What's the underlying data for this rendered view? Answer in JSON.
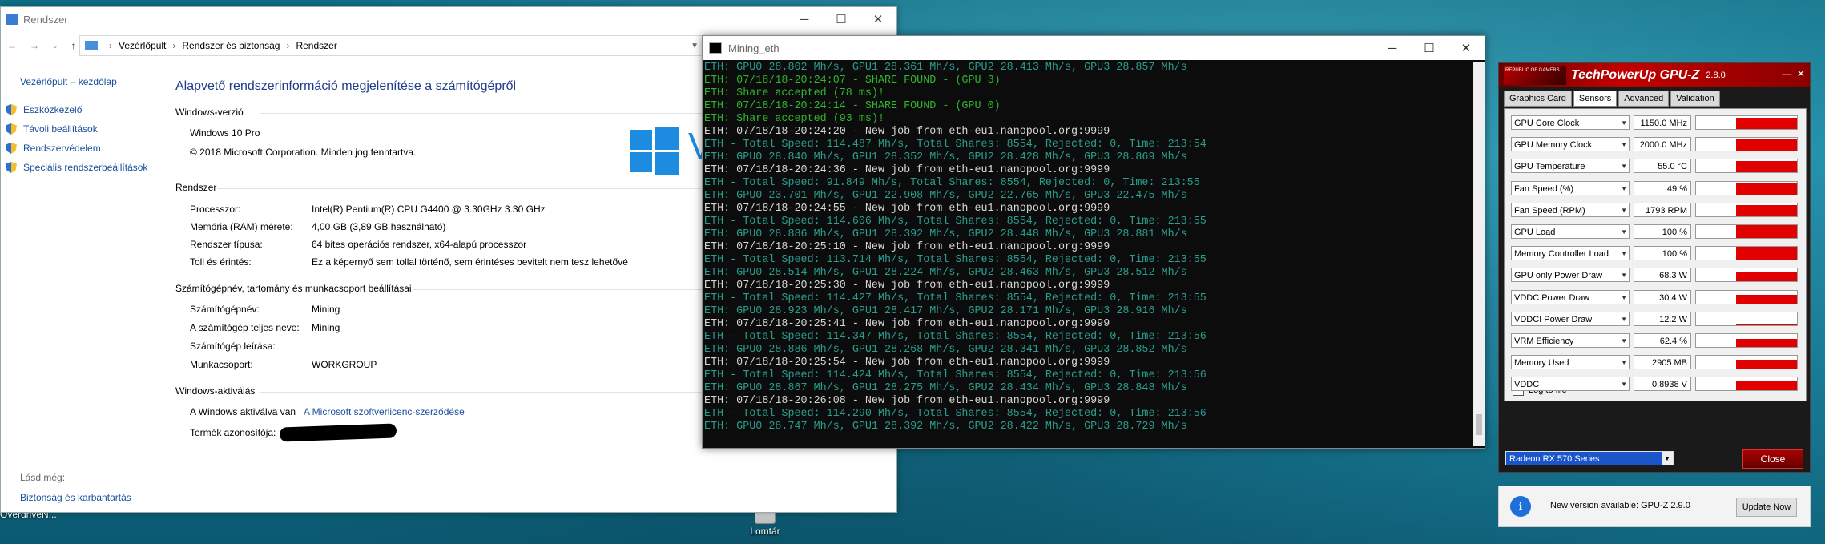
{
  "desktop": {
    "icons": [
      {
        "label": "OverdriveN...",
        "left": "0"
      },
      {
        "label": "Lomtár"
      }
    ]
  },
  "control_panel": {
    "title": "Rendszer",
    "address": [
      "Vezérlőpult",
      "Rendszer és biztonság",
      "Rendszer"
    ],
    "sidebar": {
      "home": "Vezérlőpult – kezdőlap",
      "items": [
        "Eszközkezelő",
        "Távoli beállítások",
        "Rendszervédelem",
        "Speciális rendszerbeállítások"
      ],
      "see_also": "Lásd még:",
      "see_link": "Biztonság és karbantartás"
    },
    "heading": "Alapvető rendszerinformáció megjelenítése a számítógépről",
    "windows_version": {
      "label": "Windows-verzió",
      "edition": "Windows 10 Pro",
      "copyright": "© 2018 Microsoft Corporation. Minden jog fenntartva."
    },
    "system": {
      "label": "Rendszer",
      "rows": [
        {
          "k": "Processzor:",
          "v": "Intel(R) Pentium(R) CPU G4400 @ 3.30GHz   3.30 GHz"
        },
        {
          "k": "Memória (RAM) mérete:",
          "v": "4,00 GB (3,89 GB használható)"
        },
        {
          "k": "Rendszer típusa:",
          "v": "64 bites operációs rendszer, x64-alapú processzor"
        },
        {
          "k": "Toll és érintés:",
          "v": "Ez a képernyő sem tollal történő, sem érintéses bevitelt nem tesz lehetővé"
        }
      ]
    },
    "computer": {
      "label": "Számítógépnév, tartomány és munkacsoport beállításai",
      "rows": [
        {
          "k": "Számítógépnév:",
          "v": "Mining"
        },
        {
          "k": "A számítógép teljes neve:",
          "v": "Mining"
        },
        {
          "k": "Számítógép leírása:",
          "v": ""
        },
        {
          "k": "Munkacsoport:",
          "v": "WORKGROUP"
        }
      ]
    },
    "activation": {
      "label": "Windows-aktiválás",
      "status": "A Windows aktiválva van",
      "link": "A Microsoft szoftverlicenc-szerződése",
      "product_id_label": "Termék azonosítója:"
    },
    "logo_text": "V"
  },
  "console": {
    "title": "Mining_eth",
    "lines": [
      {
        "c": "teal",
        "t": "ETH: GPU0 28.802 Mh/s, GPU1 28.361 Mh/s, GPU2 28.413 Mh/s, GPU3 28.857 Mh/s"
      },
      {
        "c": "green",
        "t": "ETH: 07/18/18-20:24:07 - SHARE FOUND - (GPU 3)"
      },
      {
        "c": "green",
        "t": "ETH: Share accepted (78 ms)!"
      },
      {
        "c": "green",
        "t": "ETH: 07/18/18-20:24:14 - SHARE FOUND - (GPU 0)"
      },
      {
        "c": "green",
        "t": "ETH: Share accepted (93 ms)!"
      },
      {
        "c": "white",
        "t": "ETH: 07/18/18-20:24:20 - New job from eth-eu1.nanopool.org:9999"
      },
      {
        "c": "teal",
        "t": "ETH - Total Speed: 114.487 Mh/s, Total Shares: 8554, Rejected: 0, Time: 213:54"
      },
      {
        "c": "teal",
        "t": "ETH: GPU0 28.840 Mh/s, GPU1 28.352 Mh/s, GPU2 28.428 Mh/s, GPU3 28.869 Mh/s"
      },
      {
        "c": "white",
        "t": "ETH: 07/18/18-20:24:36 - New job from eth-eu1.nanopool.org:9999"
      },
      {
        "c": "teal",
        "t": "ETH - Total Speed: 91.849 Mh/s, Total Shares: 8554, Rejected: 0, Time: 213:55"
      },
      {
        "c": "teal",
        "t": "ETH: GPU0 23.701 Mh/s, GPU1 22.908 Mh/s, GPU2 22.765 Mh/s, GPU3 22.475 Mh/s"
      },
      {
        "c": "white",
        "t": "ETH: 07/18/18-20:24:55 - New job from eth-eu1.nanopool.org:9999"
      },
      {
        "c": "teal",
        "t": "ETH - Total Speed: 114.606 Mh/s, Total Shares: 8554, Rejected: 0, Time: 213:55"
      },
      {
        "c": "teal",
        "t": "ETH: GPU0 28.886 Mh/s, GPU1 28.392 Mh/s, GPU2 28.448 Mh/s, GPU3 28.881 Mh/s"
      },
      {
        "c": "white",
        "t": "ETH: 07/18/18-20:25:10 - New job from eth-eu1.nanopool.org:9999"
      },
      {
        "c": "teal",
        "t": "ETH - Total Speed: 113.714 Mh/s, Total Shares: 8554, Rejected: 0, Time: 213:55"
      },
      {
        "c": "teal",
        "t": "ETH: GPU0 28.514 Mh/s, GPU1 28.224 Mh/s, GPU2 28.463 Mh/s, GPU3 28.512 Mh/s"
      },
      {
        "c": "white",
        "t": "ETH: 07/18/18-20:25:30 - New job from eth-eu1.nanopool.org:9999"
      },
      {
        "c": "teal",
        "t": "ETH - Total Speed: 114.427 Mh/s, Total Shares: 8554, Rejected: 0, Time: 213:55"
      },
      {
        "c": "teal",
        "t": "ETH: GPU0 28.923 Mh/s, GPU1 28.417 Mh/s, GPU2 28.171 Mh/s, GPU3 28.916 Mh/s"
      },
      {
        "c": "white",
        "t": "ETH: 07/18/18-20:25:41 - New job from eth-eu1.nanopool.org:9999"
      },
      {
        "c": "teal",
        "t": "ETH - Total Speed: 114.347 Mh/s, Total Shares: 8554, Rejected: 0, Time: 213:56"
      },
      {
        "c": "teal",
        "t": "ETH: GPU0 28.886 Mh/s, GPU1 28.268 Mh/s, GPU2 28.341 Mh/s, GPU3 28.852 Mh/s"
      },
      {
        "c": "white",
        "t": "ETH: 07/18/18-20:25:54 - New job from eth-eu1.nanopool.org:9999"
      },
      {
        "c": "teal",
        "t": "ETH - Total Speed: 114.424 Mh/s, Total Shares: 8554, Rejected: 0, Time: 213:56"
      },
      {
        "c": "teal",
        "t": "ETH: GPU0 28.867 Mh/s, GPU1 28.275 Mh/s, GPU2 28.434 Mh/s, GPU3 28.848 Mh/s"
      },
      {
        "c": "white",
        "t": "ETH: 07/18/18-20:26:08 - New job from eth-eu1.nanopool.org:9999"
      },
      {
        "c": "teal",
        "t": "ETH - Total Speed: 114.290 Mh/s, Total Shares: 8554, Rejected: 0, Time: 213:56"
      },
      {
        "c": "teal",
        "t": "ETH: GPU0 28.747 Mh/s, GPU1 28.392 Mh/s, GPU2 28.422 Mh/s, GPU3 28.729 Mh/s"
      }
    ]
  },
  "gpuz": {
    "logo": "REPUBLIC OF GAMERS",
    "title": "TechPowerUp GPU-Z",
    "version": "2.8.0",
    "tabs": [
      "Graphics Card",
      "Sensors",
      "Advanced",
      "Validation"
    ],
    "active_tab": "Sensors",
    "sensors": [
      {
        "name": "GPU Core Clock",
        "value": "1150.0 MHz",
        "level": 0.85
      },
      {
        "name": "GPU Memory Clock",
        "value": "2000.0 MHz",
        "level": 0.85
      },
      {
        "name": "GPU Temperature",
        "value": "55.0 °C",
        "level": 0.85
      },
      {
        "name": "Fan Speed (%)",
        "value": "49 %",
        "level": 0.85
      },
      {
        "name": "Fan Speed (RPM)",
        "value": "1793 RPM",
        "level": 0.85
      },
      {
        "name": "GPU Load",
        "value": "100 %",
        "level": 1.0
      },
      {
        "name": "Memory Controller Load",
        "value": "100 %",
        "level": 1.0
      },
      {
        "name": "GPU only Power Draw",
        "value": "68.3 W",
        "level": 0.7
      },
      {
        "name": "VDDC Power Draw",
        "value": "30.4 W",
        "level": 0.7
      },
      {
        "name": "VDDCI Power Draw",
        "value": "12.2 W",
        "level": 0.1
      },
      {
        "name": "VRM Efficiency",
        "value": "62.4 %",
        "level": 0.6
      },
      {
        "name": "Memory Used",
        "value": "2905 MB",
        "level": 0.7
      },
      {
        "name": "VDDC",
        "value": "0.8938 V",
        "level": 0.75
      }
    ],
    "log_to_file": "Log to file",
    "gpu_select": "Radeon RX 570 Series",
    "close": "Close"
  },
  "toast": {
    "message": "New version available: GPU-Z 2.9.0",
    "button": "Update Now"
  }
}
